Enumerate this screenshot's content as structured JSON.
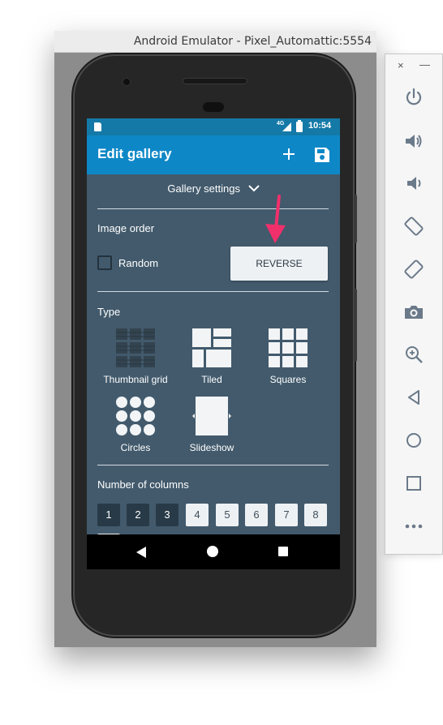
{
  "emulator": {
    "window_title": "Android Emulator - Pixel_Automattic:5554"
  },
  "statusbar": {
    "network": "4G",
    "time": "10:54"
  },
  "appbar": {
    "title": "Edit gallery",
    "add_icon": "plus-icon",
    "save_icon": "floppy-disk-icon"
  },
  "settings": {
    "header": "Gallery settings",
    "image_order_label": "Image order",
    "random_label": "Random",
    "random_checked": false,
    "reverse_label": "REVERSE",
    "type_label": "Type",
    "types": [
      {
        "label": "Thumbnail grid",
        "icon": "thumbnail-grid-icon"
      },
      {
        "label": "Tiled",
        "icon": "tiled-icon"
      },
      {
        "label": "Squares",
        "icon": "squares-icon"
      },
      {
        "label": "Circles",
        "icon": "circles-icon"
      },
      {
        "label": "Slideshow",
        "icon": "slideshow-icon"
      }
    ],
    "columns_label": "Number of columns",
    "columns": [
      "1",
      "2",
      "3",
      "4",
      "5",
      "6",
      "7",
      "8"
    ],
    "columns_selected": [
      "1",
      "2",
      "3"
    ]
  },
  "navbar": {
    "back_icon": "back-triangle-icon",
    "home_icon": "home-circle-icon",
    "recents_icon": "recents-square-icon"
  },
  "toolbar": {
    "close": "×",
    "minimize": "—",
    "items": [
      "power-icon",
      "volume-up-icon",
      "volume-down-icon",
      "rotate-left-icon",
      "rotate-right-icon",
      "camera-icon",
      "zoom-icon",
      "back-icon",
      "home-icon",
      "overview-icon",
      "more-icon"
    ]
  },
  "colors": {
    "appbar": "#0e87c7",
    "statusbar": "#1479a7",
    "content_bg": "#425a6c",
    "accent_arrow": "#f0306b"
  }
}
